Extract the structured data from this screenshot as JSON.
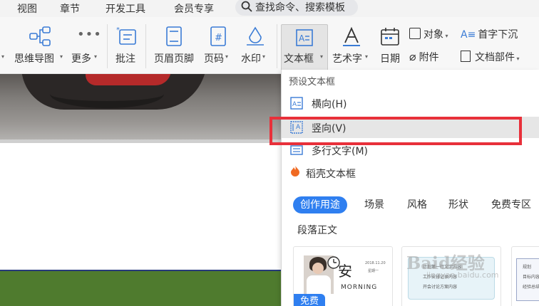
{
  "menubar": {
    "tabs": [
      "视图",
      "章节",
      "开发工具",
      "会员专享"
    ],
    "search_placeholder": "查找命令、搜索模板"
  },
  "ribbon": {
    "mindmap": "思维导图",
    "more": "更多",
    "comment": "批注",
    "header_footer": "页眉页脚",
    "page_number": "页码",
    "watermark": "水印",
    "textbox": "文本框",
    "wordart": "艺术字",
    "date": "日期",
    "object": "对象",
    "attachment": "附件",
    "drop_cap": "首字下沉",
    "doc_parts": "文档部件"
  },
  "dropdown": {
    "preset_heading": "预设文本框",
    "items": [
      {
        "label": "横向(H)"
      },
      {
        "label": "竖向(V)"
      },
      {
        "label": "多行文字(M)"
      }
    ],
    "brand_heading": "稻壳文本框",
    "chips": [
      "创作用途",
      "场景",
      "风格",
      "形状",
      "免费专区",
      "段落正文"
    ],
    "card1": {
      "title": "安",
      "subtitle": "MORNING",
      "badge": "免费",
      "date_text": "2018.11.20",
      "weekday": "星期一"
    },
    "card2": {
      "text_lines": [
        "计划第一行文字内容",
        "工作安排记录内容",
        "开会讨论方案内容"
      ]
    },
    "card3": {
      "text_lines": [
        "规划",
        "目标内容",
        "经验总结"
      ]
    }
  },
  "watermark_text": {
    "main": "Baid经验",
    "sub": "jingyan.baidu.com"
  },
  "colors": {
    "accent": "#2f7ff0",
    "highlight_box": "#e8303a",
    "doc_green": "#4f7b2e"
  }
}
